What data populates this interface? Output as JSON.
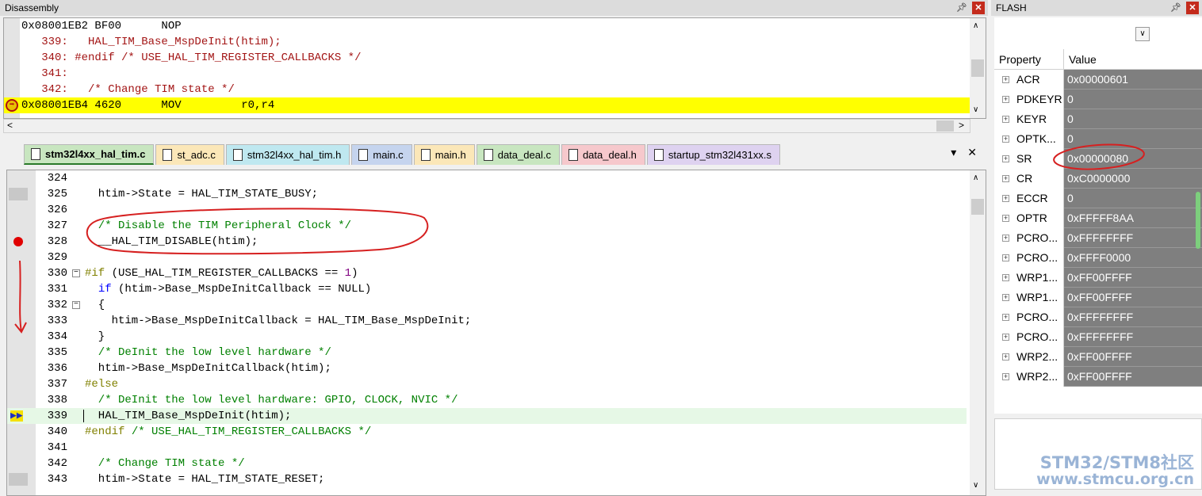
{
  "disassembly": {
    "title": "Disassembly",
    "lines": [
      "0x08001EB2 BF00      NOP",
      "   339:   HAL_TIM_Base_MspDeInit(htim);",
      "   340: #endif /* USE_HAL_TIM_REGISTER_CALLBACKS */",
      "   341: ",
      "   342:   /* Change TIM state */",
      "0x08001EB4 4620      MOV         r0,r4"
    ]
  },
  "tabs": [
    {
      "label": "stm32l4xx_hal_tim.c",
      "color": "#c8e6c0"
    },
    {
      "label": "st_adc.c",
      "color": "#fbe7b8"
    },
    {
      "label": "stm32l4xx_hal_tim.h",
      "color": "#bfe8f0"
    },
    {
      "label": "main.c",
      "color": "#c5d4ee"
    },
    {
      "label": "main.h",
      "color": "#fbe7b8"
    },
    {
      "label": "data_deal.c",
      "color": "#c8e6c0"
    },
    {
      "label": "data_deal.h",
      "color": "#f6c8cc"
    },
    {
      "label": "startup_stm32l431xx.s",
      "color": "#ded2f0"
    }
  ],
  "code": [
    {
      "n": "324",
      "t": ""
    },
    {
      "n": "325",
      "t": "  htim->State = HAL_TIM_STATE_BUSY;"
    },
    {
      "n": "326",
      "t": ""
    },
    {
      "n": "327",
      "t": "  /* Disable the TIM Peripheral Clock */"
    },
    {
      "n": "328",
      "t": "  __HAL_TIM_DISABLE(htim);"
    },
    {
      "n": "329",
      "t": ""
    },
    {
      "n": "330",
      "t": "#if (USE_HAL_TIM_REGISTER_CALLBACKS == 1)"
    },
    {
      "n": "331",
      "t": "  if (htim->Base_MspDeInitCallback == NULL)"
    },
    {
      "n": "332",
      "t": "  {"
    },
    {
      "n": "333",
      "t": "    htim->Base_MspDeInitCallback = HAL_TIM_Base_MspDeInit;"
    },
    {
      "n": "334",
      "t": "  }"
    },
    {
      "n": "335",
      "t": "  /* DeInit the low level hardware */"
    },
    {
      "n": "336",
      "t": "  htim->Base_MspDeInitCallback(htim);"
    },
    {
      "n": "337",
      "t": "#else"
    },
    {
      "n": "338",
      "t": "  /* DeInit the low level hardware: GPIO, CLOCK, NVIC */"
    },
    {
      "n": "339",
      "t": "  HAL_TIM_Base_MspDeInit(htim);"
    },
    {
      "n": "340",
      "t": "#endif /* USE_HAL_TIM_REGISTER_CALLBACKS */"
    },
    {
      "n": "341",
      "t": ""
    },
    {
      "n": "342",
      "t": "  /* Change TIM state */"
    },
    {
      "n": "343",
      "t": "  htim->State = HAL_TIM_STATE_RESET;"
    }
  ],
  "flash": {
    "title": "FLASH",
    "col_property": "Property",
    "col_value": "Value",
    "rows": [
      {
        "p": "ACR",
        "v": "0x00000601"
      },
      {
        "p": "PDKEYR",
        "v": "0"
      },
      {
        "p": "KEYR",
        "v": "0"
      },
      {
        "p": "OPTK...",
        "v": "0"
      },
      {
        "p": "SR",
        "v": "0x00000080"
      },
      {
        "p": "CR",
        "v": "0xC0000000"
      },
      {
        "p": "ECCR",
        "v": "0"
      },
      {
        "p": "OPTR",
        "v": "0xFFFFF8AA"
      },
      {
        "p": "PCRO...",
        "v": "0xFFFFFFFF"
      },
      {
        "p": "PCRO...",
        "v": "0xFFFF0000"
      },
      {
        "p": "WRP1...",
        "v": "0xFF00FFFF"
      },
      {
        "p": "WRP1...",
        "v": "0xFF00FFFF"
      },
      {
        "p": "PCRO...",
        "v": "0xFFFFFFFF"
      },
      {
        "p": "PCRO...",
        "v": "0xFFFFFFFF"
      },
      {
        "p": "WRP2...",
        "v": "0xFF00FFFF"
      },
      {
        "p": "WRP2...",
        "v": "0xFF00FFFF"
      }
    ]
  },
  "watermark": {
    "line1": "STM32/STM8社区",
    "line2": "www.stmcu.org.cn"
  },
  "icons": {
    "pin": "pin-icon",
    "close": "close-icon",
    "dropdown": "chevron-down-icon",
    "breakpoint": "breakpoint-icon",
    "current_pc": "current-instruction-icon"
  }
}
